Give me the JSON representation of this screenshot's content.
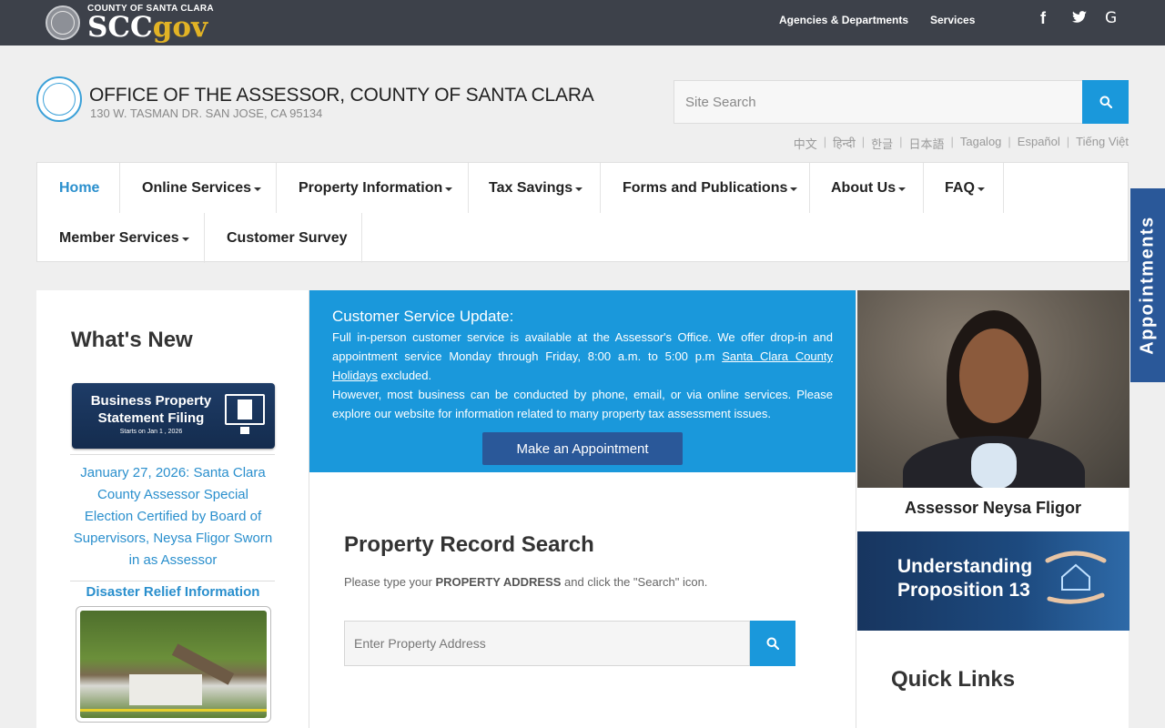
{
  "topbar": {
    "brand_county": "COUNTY OF SANTA CLARA",
    "brand_scc": "SCC",
    "brand_gov": "gov",
    "nav": [
      "Agencies & Departments",
      "Services"
    ],
    "social_icons": [
      "facebook-icon",
      "twitter-icon",
      "google-icon"
    ]
  },
  "header": {
    "title": "OFFICE OF THE ASSESSOR, COUNTY OF SANTA CLARA",
    "address": "130 W. TASMAN DR. SAN JOSE, CA 95134",
    "search_placeholder": "Site Search",
    "languages": [
      "中文",
      "हिन्दी",
      "한글",
      "日本語",
      "Tagalog",
      "Español",
      "Tiếng Việt"
    ]
  },
  "nav": {
    "items": [
      {
        "label": "Home",
        "dropdown": false,
        "active": true
      },
      {
        "label": "Online Services",
        "dropdown": true
      },
      {
        "label": "Property Information",
        "dropdown": true
      },
      {
        "label": "Tax Savings",
        "dropdown": true
      },
      {
        "label": "Forms and Publications",
        "dropdown": true
      },
      {
        "label": "About Us",
        "dropdown": true
      },
      {
        "label": "FAQ",
        "dropdown": true
      },
      {
        "label": "Member Services",
        "dropdown": true
      },
      {
        "label": "Customer Survey",
        "dropdown": false
      }
    ]
  },
  "appointments_tab": "Appointments",
  "whats_new": {
    "title": "What's New",
    "banner_title": "Business Property Statement Filing",
    "banner_sub": "Starts on  Jan 1 , 2026",
    "news_link": "January 27, 2026: Santa Clara County Assessor Special Election Certified by Board of Supervisors, Neysa Fligor Sworn in as Assessor",
    "disaster_link": "Disaster Relief Information"
  },
  "customer_service": {
    "title": "Customer Service Update:",
    "p1_before": "Full in-person customer service is available at the Assessor's Office. We offer drop-in and appointment service Monday through Friday, 8:00 a.m. to 5:00 p.m ",
    "p1_link": "Santa Clara County Holidays",
    "p1_after": " excluded.",
    "p2": "However, most business can be conducted by phone, email, or via online services. Please explore our website for information related to many property tax assessment issues.",
    "button": "Make an Appointment"
  },
  "property_search": {
    "title": "Property Record Search",
    "desc_before": "Please type your ",
    "desc_bold": "PROPERTY ADDRESS",
    "desc_after": " and click the \"Search\" icon.",
    "placeholder": "Enter Property Address"
  },
  "right": {
    "assessor_name": "Assessor Neysa Fligor",
    "prop13_line1": "Understanding",
    "prop13_line2": "Proposition 13",
    "quick_links": "Quick Links"
  },
  "colors": {
    "topbar": "#3d414a",
    "accent_blue": "#1a98db",
    "dark_blue": "#2a5899",
    "link_blue": "#2a8fcd",
    "gov_gold": "#e2b325"
  }
}
